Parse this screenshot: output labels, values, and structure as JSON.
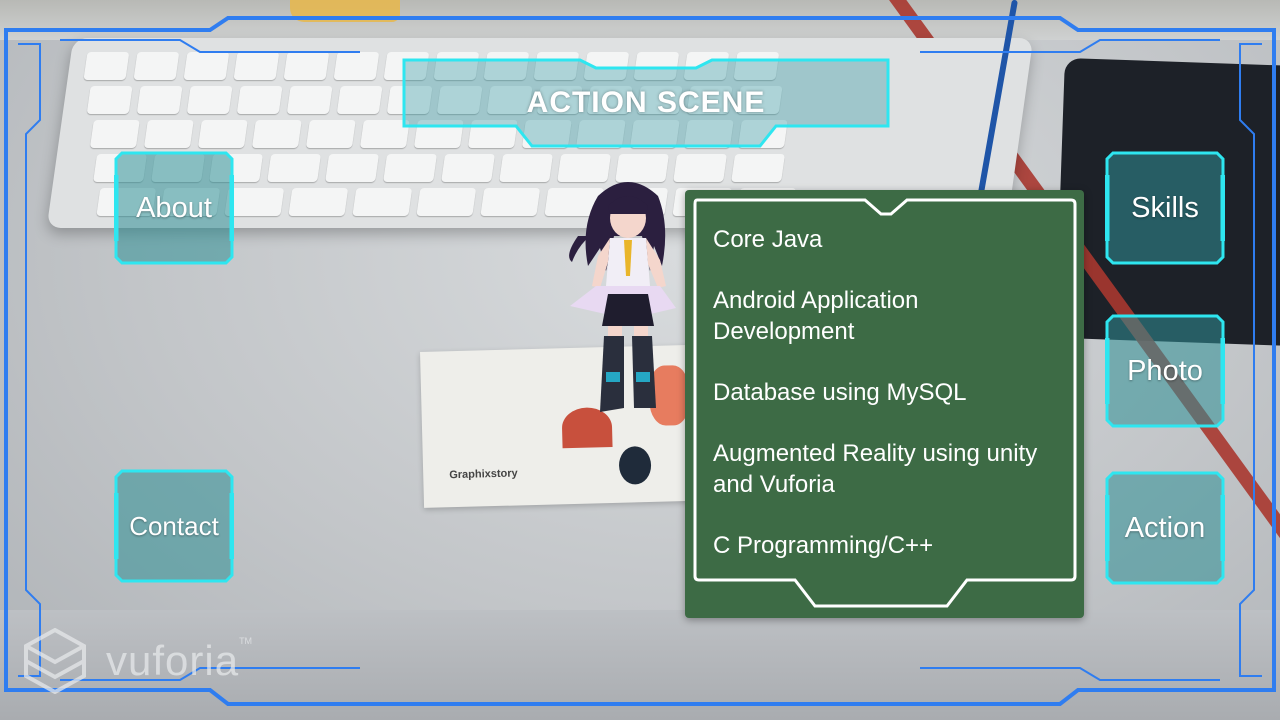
{
  "title": "ACTION SCENE",
  "nav": {
    "left": [
      {
        "label": "About"
      },
      {
        "label": "Contact"
      }
    ],
    "right": [
      {
        "label": "Skills"
      },
      {
        "label": "Photo"
      },
      {
        "label": "Action"
      }
    ]
  },
  "skills_panel": {
    "items": [
      "Core Java",
      "Android Application Development",
      "Database using MySQL",
      "Augmented Reality using unity and Vuforia",
      "C Programming/C++"
    ]
  },
  "card_text": "Graphixstory",
  "watermark": {
    "brand": "vuforia",
    "tm": "TM"
  },
  "colors": {
    "hud_blue": "#2f7df0",
    "hud_cyan": "#2ee6f0",
    "button_fill": "#2f8f96",
    "panel_green": "#3d6b45"
  }
}
